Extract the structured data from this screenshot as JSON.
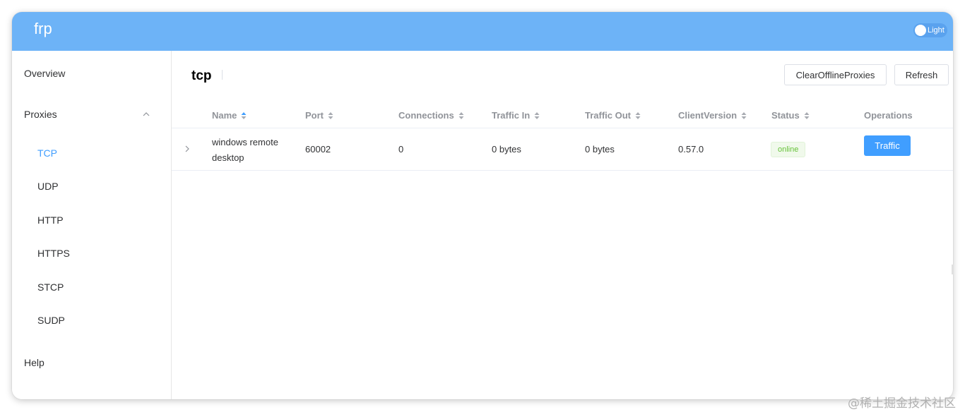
{
  "header": {
    "brand": "frp",
    "theme_toggle_label": "Light",
    "color": "#6db3f7"
  },
  "sidebar": {
    "overview": "Overview",
    "proxies": "Proxies",
    "proxy_types": [
      "TCP",
      "UDP",
      "HTTP",
      "HTTPS",
      "STCP",
      "SUDP"
    ],
    "active_type": "TCP",
    "help": "Help",
    "active_color": "#409eff"
  },
  "main": {
    "title": "tcp",
    "clear_button": "ClearOfflineProxies",
    "refresh_button": "Refresh"
  },
  "table": {
    "columns": [
      "Name",
      "Port",
      "Connections",
      "Traffic In",
      "Traffic Out",
      "ClientVersion",
      "Status",
      "Operations"
    ],
    "rows": [
      {
        "name": "windows remote desktop",
        "port": "60002",
        "connections": "0",
        "traffic_in": "0 bytes",
        "traffic_out": "0 bytes",
        "client_version": "0.57.0",
        "status": "online",
        "operation": "Traffic"
      }
    ]
  },
  "watermark": "@稀土掘金技术社区"
}
